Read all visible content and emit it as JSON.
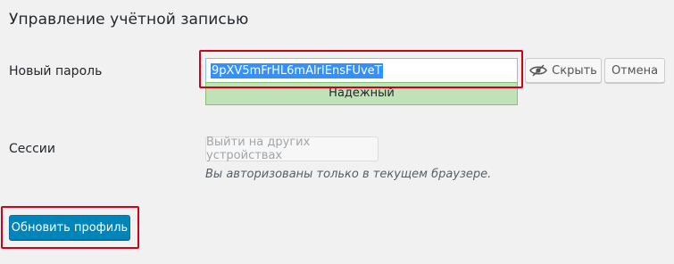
{
  "section": {
    "title": "Управление учётной записью"
  },
  "password": {
    "label": "Новый пароль",
    "value": "9pXV5mFrHL6mAlrIEnsFUveT",
    "strength": "Надёжный",
    "hide_button": "Скрыть",
    "cancel_button": "Отмена",
    "eye_icon": "eye-slash-icon"
  },
  "sessions": {
    "label": "Сессии",
    "logout_button": "Выйти на других устройствах",
    "note": "Вы авторизованы только в текущем браузере."
  },
  "actions": {
    "update_button": "Обновить профиль"
  },
  "colors": {
    "highlight": "#d0021b",
    "primary": "#0085ba",
    "strength_bg": "#c1e1b9",
    "selection": "#3390ff"
  }
}
